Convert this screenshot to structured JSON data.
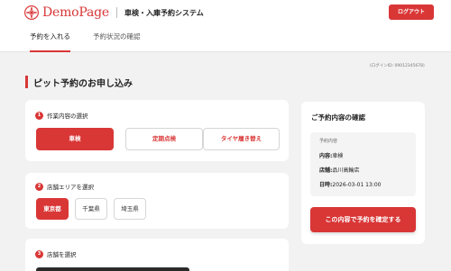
{
  "header": {
    "brand_name": "DemoPage",
    "system_title": "車検・入庫予約システム",
    "logout_label": "ログアウト"
  },
  "nav": {
    "items": [
      {
        "label": "予約を入れる",
        "active": true
      },
      {
        "label": "予約状況の確認",
        "active": false
      }
    ]
  },
  "login_id": "(ログインID: 09012345678)",
  "page_title": "ピット予約のお申し込み",
  "steps": [
    {
      "number": "1",
      "label": "作業内容の選択",
      "options": [
        {
          "label": "車検",
          "selected": true
        },
        {
          "label": "定期点検",
          "selected": false
        },
        {
          "label": "タイヤ履き替え",
          "selected": false
        }
      ]
    },
    {
      "number": "2",
      "label": "店舗エリアを選択",
      "options": [
        {
          "label": "東京都",
          "selected": true
        },
        {
          "label": "千葉県",
          "selected": false
        },
        {
          "label": "埼玉県",
          "selected": false
        }
      ]
    },
    {
      "number": "3",
      "label": "店舗を選択",
      "options": []
    }
  ],
  "confirm": {
    "title": "ご予約内容の確認",
    "summary_heading": "予約内容",
    "rows": [
      {
        "key": "内容:",
        "value": "車検"
      },
      {
        "key": "店舗:",
        "value": "品川高輪店"
      },
      {
        "key": "日時:",
        "value": "2026-03-01 13:00"
      }
    ],
    "button_label": "この内容で予約を確定する"
  },
  "colors": {
    "accent": "#d93636",
    "background": "#f2f2f2",
    "card": "#ffffff"
  },
  "icons": {
    "logo": "brand-logo-icon"
  }
}
